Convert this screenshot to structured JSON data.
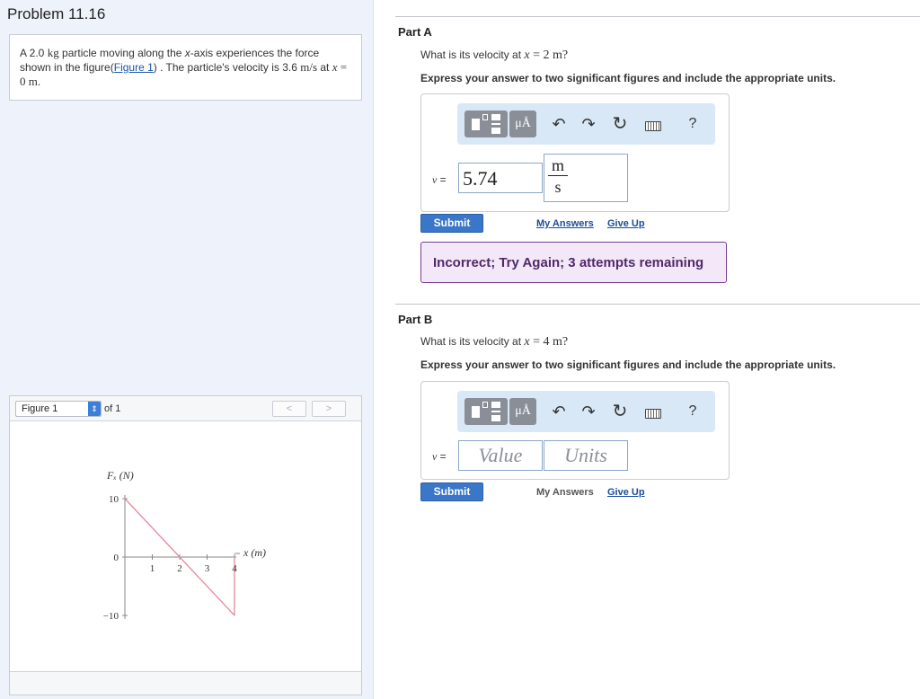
{
  "problem": {
    "title": "Problem 11.16",
    "text_a": "A 2.0 ",
    "mass_unit": "kg",
    "text_b": " particle moving along the ",
    "axis_var": "x",
    "text_c": "-axis experiences the force shown in the figure(",
    "figure_link": "Figure 1",
    "text_d": ") . The particle's velocity is 3.6 ",
    "velocity_unit": "m/s",
    "text_e": " at ",
    "x_var": "x",
    "text_f": " = 0 m."
  },
  "figure": {
    "selected": "Figure 1",
    "of_text": "of 1",
    "prev_label": "<",
    "next_label": ">",
    "y_axis_label": "Fₓ (N)",
    "x_axis_label": "x (m)"
  },
  "chart_data": {
    "type": "line",
    "x": [
      0,
      4,
      4
    ],
    "values": [
      10,
      -10,
      -10
    ],
    "x_ticks": [
      "1",
      "2",
      "3",
      "4"
    ],
    "y_ticks": [
      "10",
      "0",
      "−10"
    ],
    "xlabel": "x (m)",
    "ylabel": "Fₓ (N)",
    "xlim": [
      0,
      4
    ],
    "ylim": [
      -10,
      10
    ],
    "series_color": "#e8879b",
    "series": [
      {
        "x": [
          0,
          4
        ],
        "values": [
          10,
          -10
        ]
      },
      {
        "x": [
          4,
          4
        ],
        "values": [
          -10,
          0
        ]
      }
    ]
  },
  "partA": {
    "title": "Part A",
    "question_pre": "What is its velocity at ",
    "question_var": "x",
    "question_val": " = 2 m?",
    "instruction": "Express your answer to two significant figures and include the appropriate units.",
    "var_label": "v",
    "eq": " =",
    "value": "5.74",
    "unit_num": "m",
    "unit_den": "s",
    "submit": "Submit",
    "my_answers": "My Answers",
    "give_up": "Give Up",
    "feedback": "Incorrect; Try Again; 3 attempts remaining"
  },
  "partB": {
    "title": "Part B",
    "question_pre": "What is its velocity at ",
    "question_var": "x",
    "question_val": " = 4 m?",
    "instruction": "Express your answer to two significant figures and include the appropriate units.",
    "var_label": "v",
    "eq": " =",
    "value_placeholder": "Value",
    "units_placeholder": "Units",
    "submit": "Submit",
    "my_answers": "My Answers",
    "give_up": "Give Up"
  },
  "toolbar": {
    "units_label": "μÅ",
    "undo_icon": "undo-icon",
    "redo_icon": "redo-icon",
    "reset_icon": "reset-icon",
    "keyboard_icon": "keyboard-icon",
    "help_label": "?"
  },
  "colors": {
    "accent": "#3a77c9",
    "feedback_border": "#7a3d93",
    "feedback_bg": "#f3e8f8",
    "toolbar_bg": "#d9e8f7"
  }
}
